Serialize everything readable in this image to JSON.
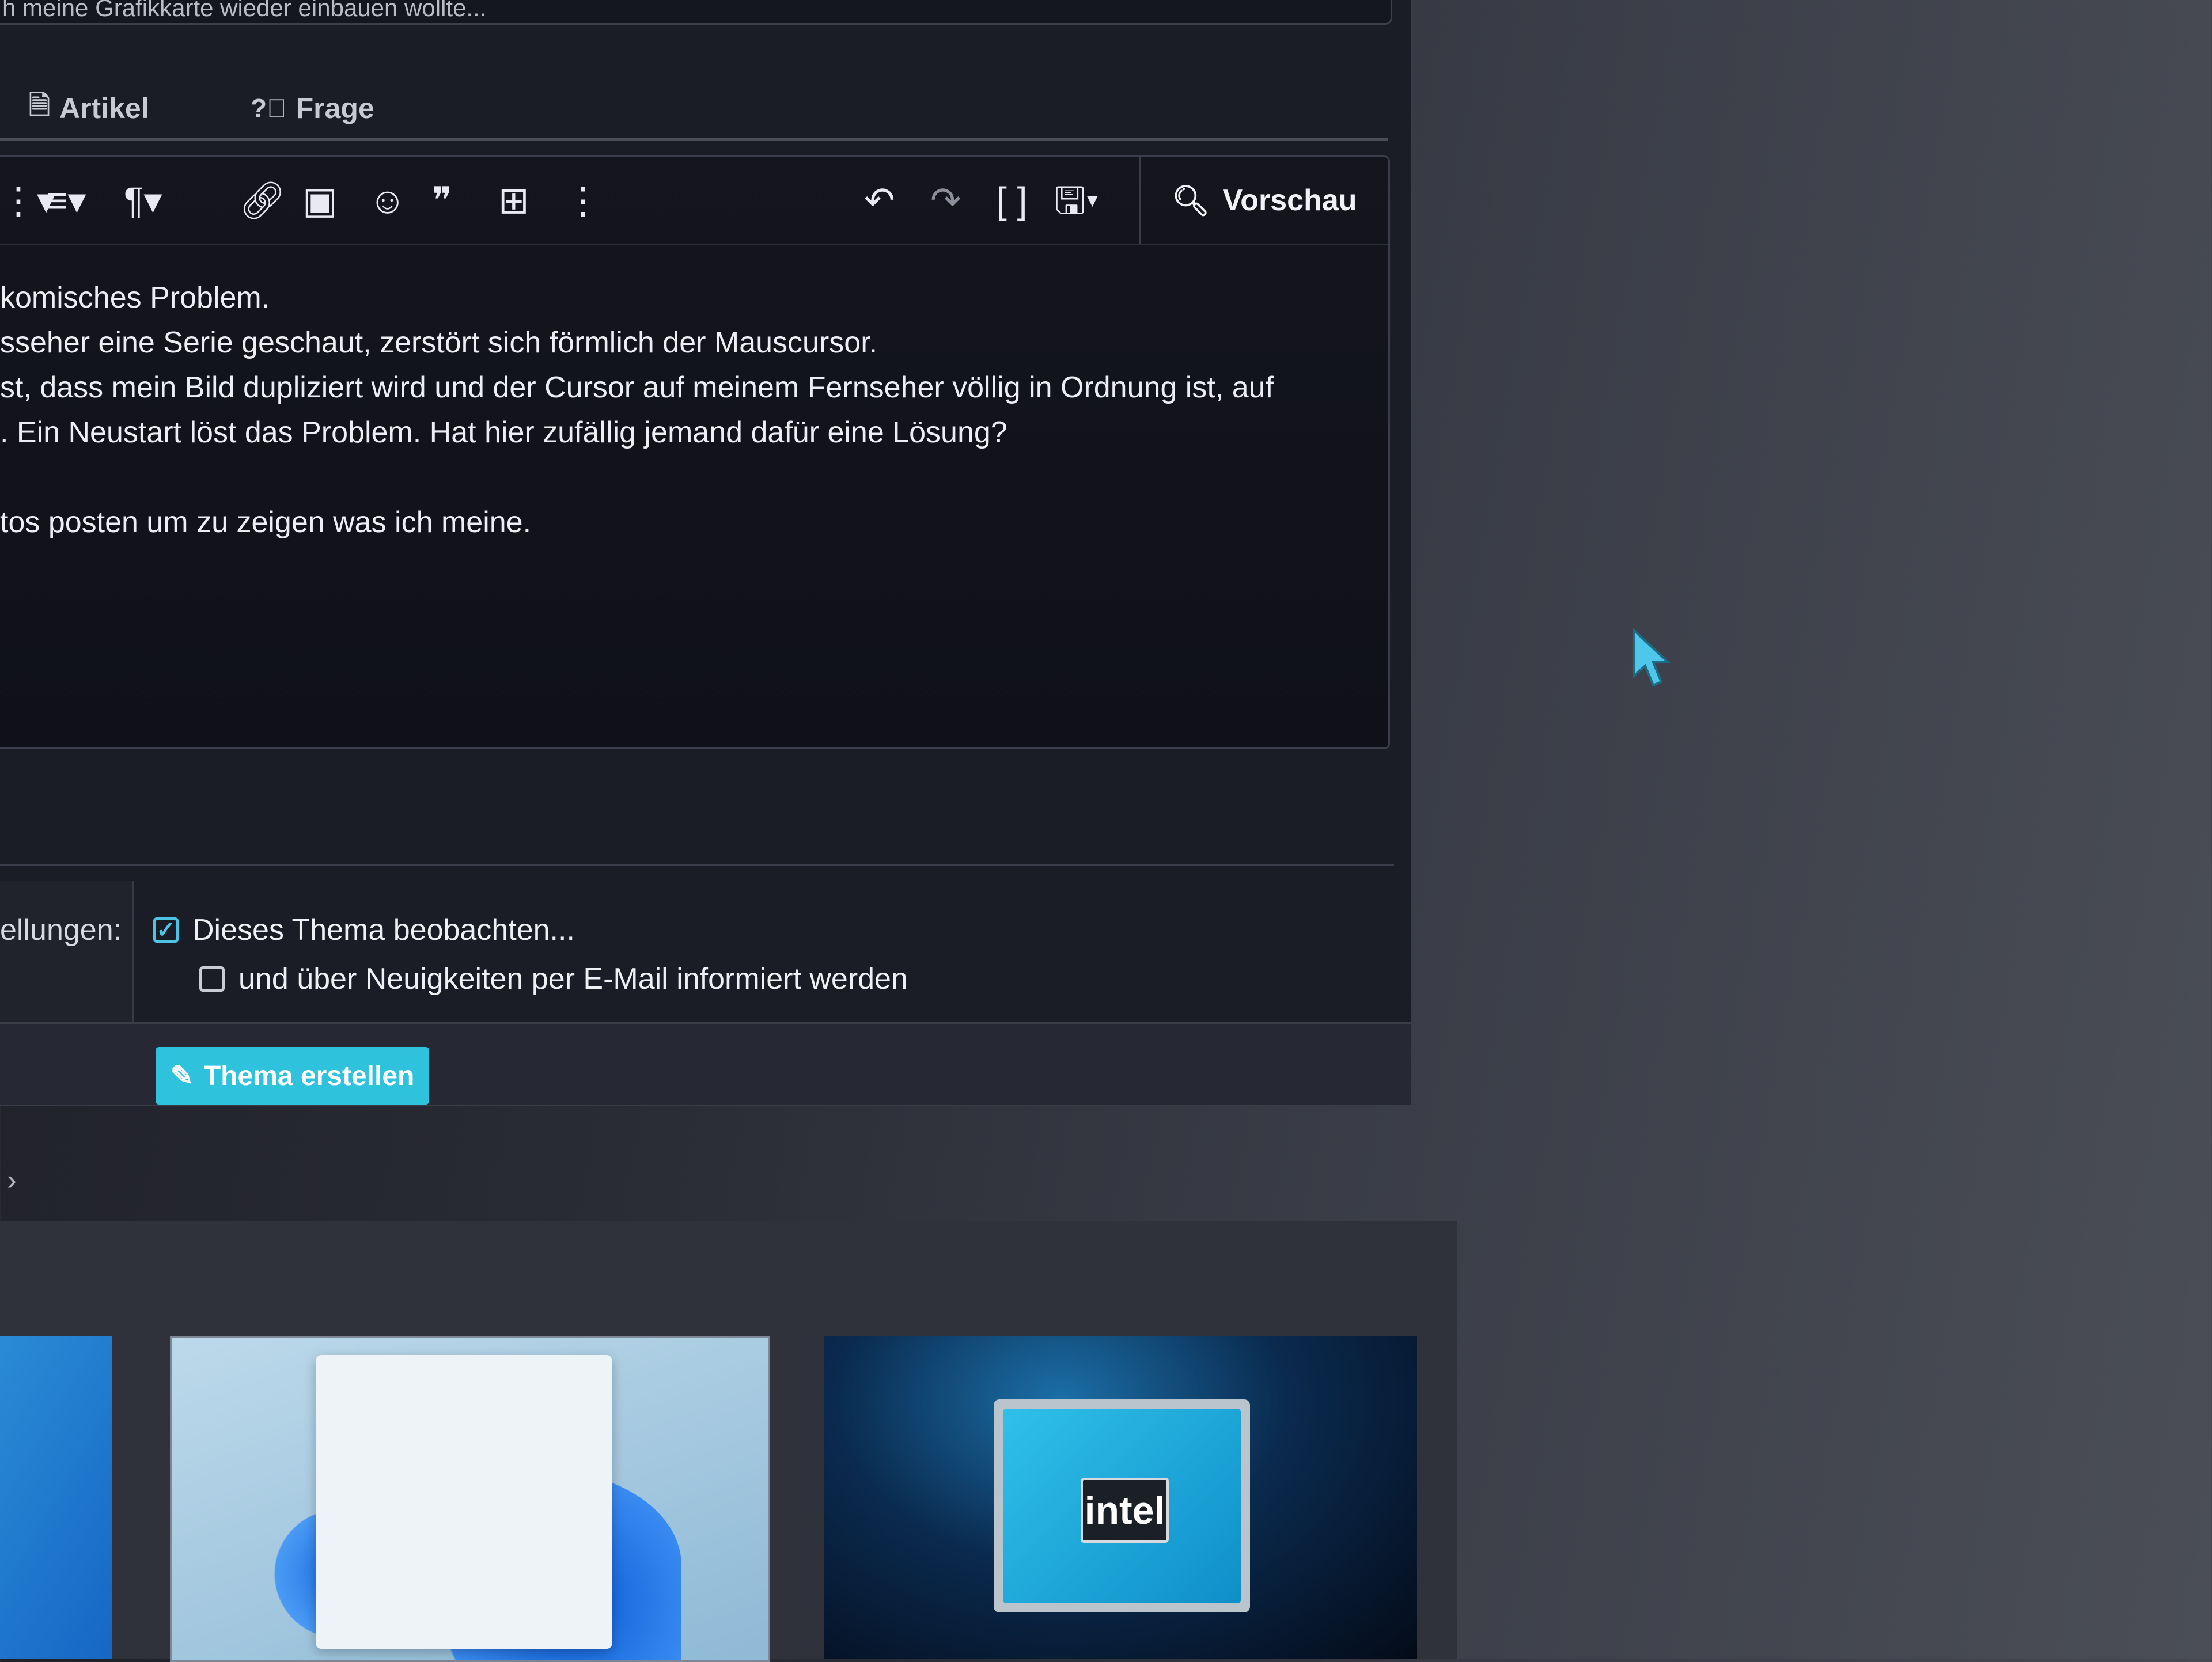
{
  "title_field": {
    "value": "h meine Grafikkarte wieder einbauen wollte..."
  },
  "tabs": [
    {
      "label": "Artikel",
      "icon": "document-icon"
    },
    {
      "label": "Frage",
      "icon": "question-circle-icon"
    }
  ],
  "toolbar": {
    "preview_label": "Vorschau"
  },
  "editor": {
    "lines": [
      "komisches Problem.",
      "sseher eine Serie geschaut, zerstört sich förmlich der Mauscursor.",
      "st, dass mein Bild dupliziert wird und der Cursor auf meinem Fernseher völlig in Ordnung ist, auf",
      ". Ein Neustart löst das Problem. Hat hier zufällig jemand dafür eine Lösung?",
      "",
      "tos posten um zu zeigen was ich meine."
    ]
  },
  "options": {
    "label": "ellungen:",
    "watch_label": "Dieses Thema beobachten...",
    "watch_checked": true,
    "email_label": "und über Neuigkeiten per E-Mail informiert werden",
    "email_checked": false
  },
  "submit": {
    "label": "Thema erstellen"
  },
  "breadcrumb": {
    "chevron": "›"
  },
  "gallery": {
    "intel_text": "intel"
  },
  "colors": {
    "accent": "#2ec2dd",
    "panel": "#1b1d26",
    "background": "#2a2c36"
  }
}
